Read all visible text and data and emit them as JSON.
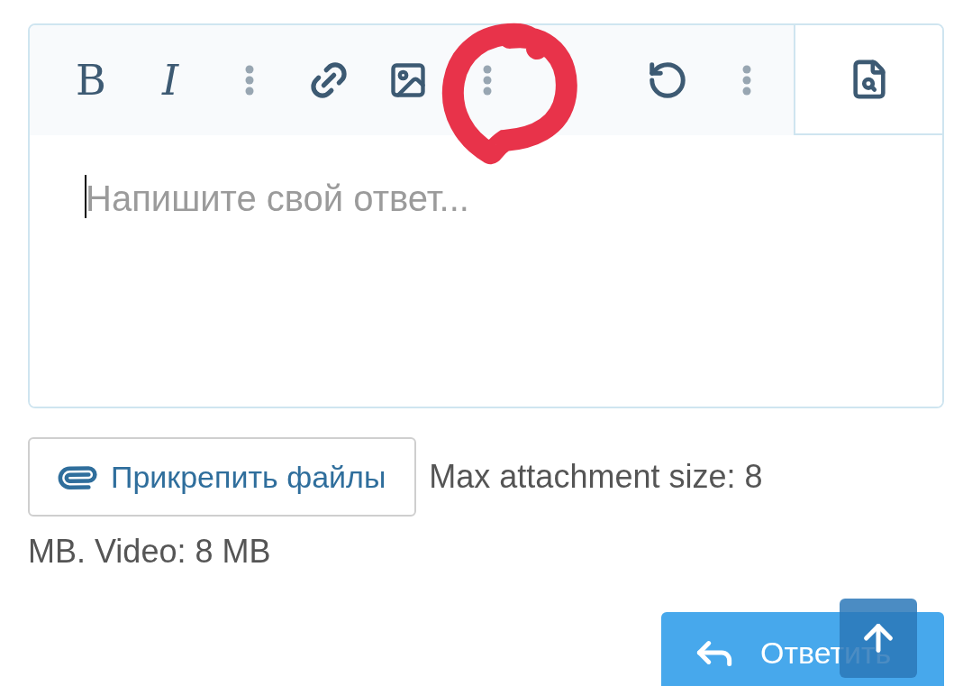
{
  "toolbar": {
    "groups": [
      [
        {
          "kind": "bold",
          "label": "B"
        },
        {
          "kind": "italic",
          "label": "I"
        },
        {
          "kind": "more"
        },
        {
          "kind": "link"
        },
        {
          "kind": "image"
        },
        {
          "kind": "more"
        }
      ],
      [
        {
          "kind": "undo"
        },
        {
          "kind": "more"
        }
      ]
    ],
    "side": [
      {
        "kind": "preview"
      }
    ]
  },
  "editor": {
    "placeholder": "Напишите свой ответ..."
  },
  "attach_button": {
    "label": "Прикрепить файлы"
  },
  "attach_note": [
    "Max attachment size: 8",
    "MB. Video: 8 MB"
  ],
  "reply_button": {
    "label": "Ответить"
  },
  "scroll_top_button": {
    "kind": "up"
  },
  "annotations": [
    {
      "kind": "scribble-circle"
    }
  ]
}
